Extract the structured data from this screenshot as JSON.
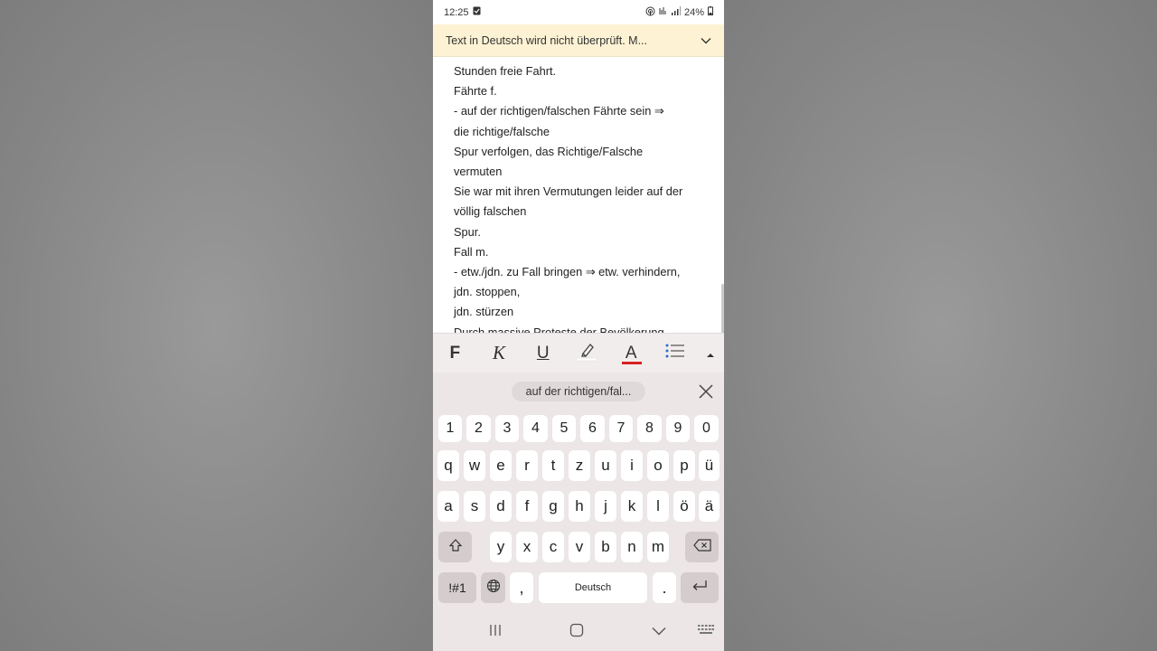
{
  "status_bar": {
    "time": "12:25",
    "battery": "24%"
  },
  "banner": {
    "text": "Text in Deutsch wird nicht überprüft. M..."
  },
  "document": {
    "lines": [
      "Stunden freie Fahrt.",
      "Fährte f.",
      "- auf der richtigen/falschen Fährte sein ⇒",
      "die richtige/falsche",
      "Spur verfolgen, das Richtige/Falsche",
      "vermuten",
      "Sie war mit ihren Vermutungen leider auf der",
      "völlig falschen",
      "Spur.",
      "Fall m.",
      "- etw./jdn. zu Fall bringen ⇒ etw. verhindern,",
      "jdn. stoppen,",
      "jdn. stürzen",
      "Durch massive Proteste der Bevölkerung"
    ]
  },
  "format_toolbar": {
    "bold_label": "F",
    "italic_label": "K",
    "underline_label": "U",
    "font_color_label": "A",
    "font_color": "#d8211e"
  },
  "keyboard": {
    "suggestion": "auf der richtigen/fal...",
    "number_row": [
      "1",
      "2",
      "3",
      "4",
      "5",
      "6",
      "7",
      "8",
      "9",
      "0"
    ],
    "row1": [
      "q",
      "w",
      "e",
      "r",
      "t",
      "z",
      "u",
      "i",
      "o",
      "p",
      "ü"
    ],
    "row2": [
      "a",
      "s",
      "d",
      "f",
      "g",
      "h",
      "j",
      "k",
      "l",
      "ö",
      "ä"
    ],
    "row3": [
      "y",
      "x",
      "c",
      "v",
      "b",
      "n",
      "m"
    ],
    "symbols_key": "!#1",
    "comma_key": ",",
    "space_label": "Deutsch",
    "period_key": "."
  }
}
